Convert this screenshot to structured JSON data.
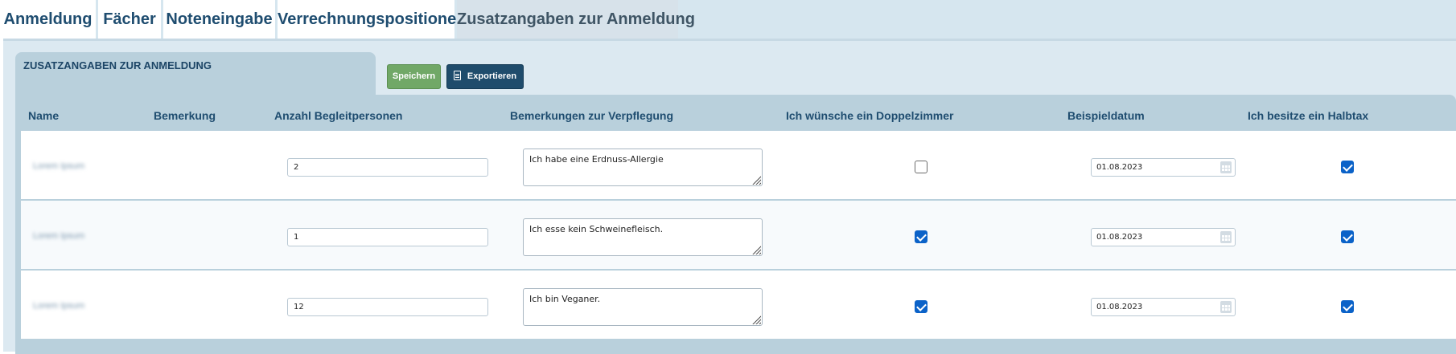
{
  "tabs": [
    {
      "label": "Anmeldung",
      "active": false
    },
    {
      "label": "Fächer",
      "active": false
    },
    {
      "label": "Noteneingabe",
      "active": false
    },
    {
      "label": "Verrechnungspositionen",
      "active": false
    },
    {
      "label": "Zusatzangaben zur Anmeldung",
      "active": true
    }
  ],
  "panel": {
    "title": "ZUSATZANGABEN ZUR ANMELDUNG",
    "save_label": "Speichern",
    "export_label": "Exportieren"
  },
  "table": {
    "headers": [
      "Name",
      "Bemerkung",
      "Anzahl Begleitpersonen",
      "Bemerkungen zur Verpflegung",
      "Ich wünsche ein Doppelzimmer",
      "Beispieldatum",
      "Ich besitze ein Halbtax"
    ],
    "rows": [
      {
        "name": "Lorem Ipsum",
        "bemerkung": "",
        "begleitpersonen": "2",
        "verpflegung": "Ich habe eine Erdnuss-Allergie",
        "doppelzimmer": false,
        "datum": "01.08.2023",
        "halbtax": true
      },
      {
        "name": "Lorem Ipsum",
        "bemerkung": "",
        "begleitpersonen": "1",
        "verpflegung": "Ich esse kein Schweinefleisch.",
        "doppelzimmer": true,
        "datum": "01.08.2023",
        "halbtax": true
      },
      {
        "name": "Lorem Ipsum",
        "bemerkung": "",
        "begleitpersonen": "12",
        "verpflegung": "Ich bin Veganer.",
        "doppelzimmer": true,
        "datum": "01.08.2023",
        "halbtax": true
      }
    ]
  },
  "colors": {
    "accent": "#1f4d70",
    "save": "#71a867",
    "export": "#1f4c6c",
    "checkbox": "#0b62c8"
  },
  "icons": {
    "export": "document-icon",
    "date": "calendar-icon"
  }
}
